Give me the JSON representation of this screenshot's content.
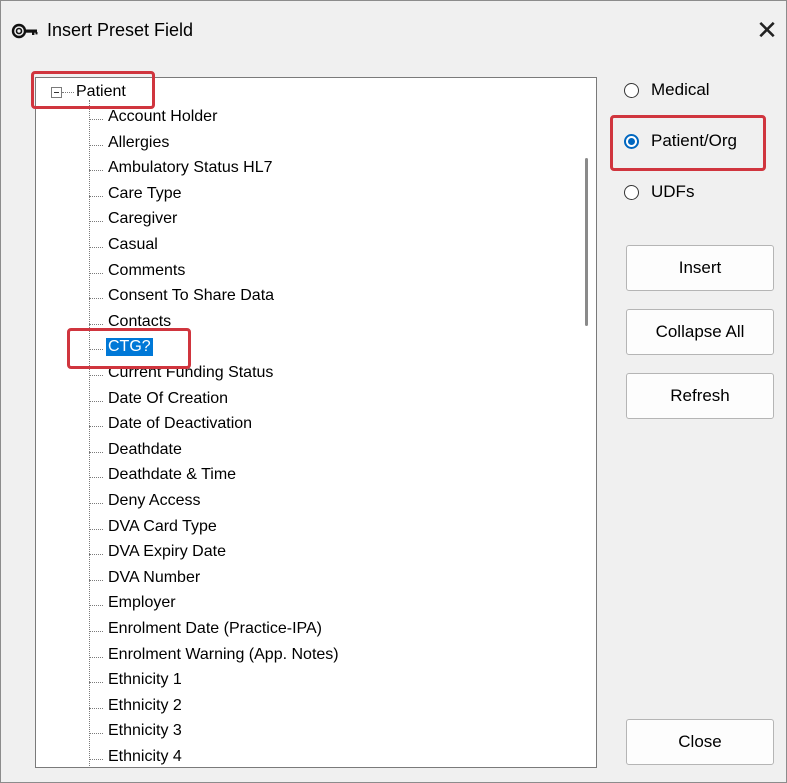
{
  "window": {
    "title": "Insert Preset Field",
    "close_glyph": "✕"
  },
  "tree": {
    "root_label": "Patient",
    "items": [
      "Account Holder",
      "Allergies",
      "Ambulatory Status HL7",
      "Care Type",
      "Caregiver",
      "Casual",
      "Comments",
      "Consent To Share Data",
      "Contacts",
      "CTG?",
      "Current Funding Status",
      "Date Of Creation",
      "Date of Deactivation",
      "Deathdate",
      "Deathdate & Time",
      "Deny Access",
      "DVA Card Type",
      "DVA Expiry Date",
      "DVA Number",
      "Employer",
      "Enrolment Date (Practice-IPA)",
      "Enrolment Warning (App. Notes)",
      "Ethnicity 1",
      "Ethnicity 2",
      "Ethnicity 3",
      "Ethnicity 4"
    ],
    "selected_item": "CTG?"
  },
  "options": {
    "selected": "Patient/Org",
    "radios": [
      {
        "label": "Medical",
        "checked": false
      },
      {
        "label": "Patient/Org",
        "checked": true
      },
      {
        "label": "UDFs",
        "checked": false
      }
    ]
  },
  "buttons": {
    "insert": "Insert",
    "collapse_all": "Collapse All",
    "refresh": "Refresh",
    "close": "Close"
  },
  "colors": {
    "selection": "#0078d7",
    "highlight_box": "#d0353e",
    "radio_accent": "#0067c0"
  },
  "icons": {
    "app": "key-icon",
    "tree_expander": "minus-expander-icon"
  }
}
